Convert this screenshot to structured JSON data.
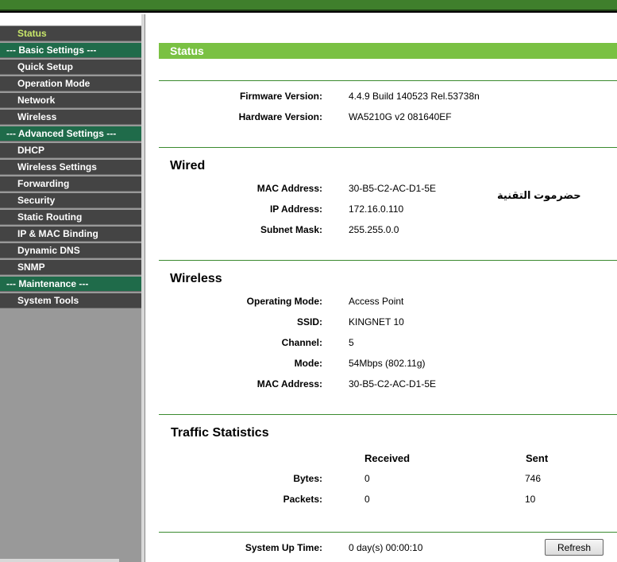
{
  "sidebar": {
    "items": [
      {
        "label": "Status",
        "kind": "item",
        "active": true
      },
      {
        "label": "--- Basic Settings ---",
        "kind": "header"
      },
      {
        "label": "Quick Setup",
        "kind": "item"
      },
      {
        "label": "Operation Mode",
        "kind": "item"
      },
      {
        "label": "Network",
        "kind": "item"
      },
      {
        "label": "Wireless",
        "kind": "item"
      },
      {
        "label": "--- Advanced Settings ---",
        "kind": "header"
      },
      {
        "label": "DHCP",
        "kind": "item"
      },
      {
        "label": "Wireless Settings",
        "kind": "item"
      },
      {
        "label": "Forwarding",
        "kind": "item"
      },
      {
        "label": "Security",
        "kind": "item"
      },
      {
        "label": "Static Routing",
        "kind": "item"
      },
      {
        "label": "IP & MAC Binding",
        "kind": "item"
      },
      {
        "label": "Dynamic DNS",
        "kind": "item"
      },
      {
        "label": "SNMP",
        "kind": "item"
      },
      {
        "label": "--- Maintenance ---",
        "kind": "header"
      },
      {
        "label": "System Tools",
        "kind": "item"
      }
    ]
  },
  "page": {
    "title": "Status"
  },
  "info": {
    "firmware_label": "Firmware Version:",
    "firmware_value": "4.4.9 Build 140523 Rel.53738n",
    "hardware_label": "Hardware Version:",
    "hardware_value": "WA5210G v2 081640EF"
  },
  "wired": {
    "title": "Wired",
    "mac_label": "MAC Address:",
    "mac_value": "30-B5-C2-AC-D1-5E",
    "ip_label": "IP Address:",
    "ip_value": "172.16.0.110",
    "mask_label": "Subnet Mask:",
    "mask_value": "255.255.0.0"
  },
  "watermark": "حضرموت التقنية",
  "wireless": {
    "title": "Wireless",
    "opmode_label": "Operating Mode:",
    "opmode_value": "Access Point",
    "ssid_label": "SSID:",
    "ssid_value": "KINGNET 10",
    "channel_label": "Channel:",
    "channel_value": "5",
    "mode_label": "Mode:",
    "mode_value": "54Mbps (802.11g)",
    "mac_label": "MAC Address:",
    "mac_value": "30-B5-C2-AC-D1-5E"
  },
  "traffic": {
    "title": "Traffic Statistics",
    "received_header": "Received",
    "sent_header": "Sent",
    "bytes_label": "Bytes:",
    "bytes_received": "0",
    "bytes_sent": "746",
    "packets_label": "Packets:",
    "packets_received": "0",
    "packets_sent": "10"
  },
  "uptime": {
    "label": "System Up Time:",
    "value": "0 day(s) 00:00:10"
  },
  "refresh_label": "Refresh",
  "colors": {
    "accent_green": "#7ac143",
    "sidebar_header": "#1f6b4a",
    "sidebar_item": "#444444",
    "active_text": "#c8e66a"
  }
}
